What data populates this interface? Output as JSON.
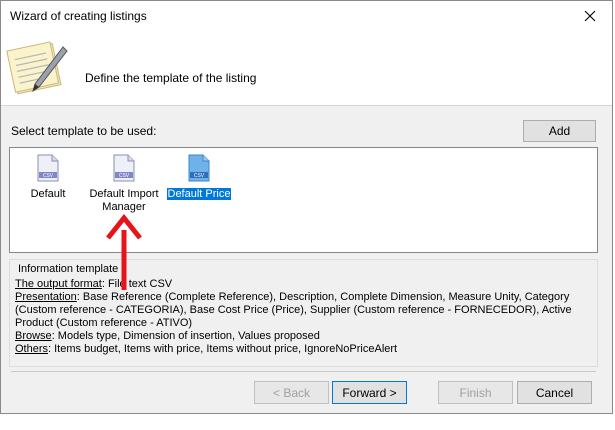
{
  "window": {
    "title": "Wizard of creating listings"
  },
  "header": {
    "text": "Define the template of the listing",
    "icon": "notepad-pen-icon"
  },
  "selector": {
    "label": "Select template to be used:",
    "add_label": "Add"
  },
  "templates": [
    {
      "label": "Default",
      "icon_text": "CSV",
      "selected": false
    },
    {
      "label_line1": "Default Import",
      "label_line2": "Manager",
      "icon_text": "CSV",
      "selected": false
    },
    {
      "label": "Default Price",
      "icon_text": "CSV",
      "selected": true
    }
  ],
  "info": {
    "title": "Information template",
    "output_label": "The output format",
    "output_value": ": File text CSV",
    "presentation_label": "Presentation",
    "presentation_value": ": Base Reference (Complete Reference), Description, Complete Dimension, Measure Unity, Category (Custom reference - CATEGORIA), Base Cost Price (Price), Supplier (Custom reference - FORNECEDOR), Active Product (Custom reference - ATIVO)",
    "browse_label": "Browse",
    "browse_value": ": Models type, Dimension of insertion, Values proposed",
    "others_label": "Others",
    "others_value": ": Items budget, Items with price, Items without price, IgnoreNoPriceAlert"
  },
  "buttons": {
    "back": "< Back",
    "forward": "Forward >",
    "finish": "Finish",
    "cancel": "Cancel"
  },
  "colors": {
    "selection": "#0078d7",
    "annotation_arrow": "#e8121b"
  }
}
